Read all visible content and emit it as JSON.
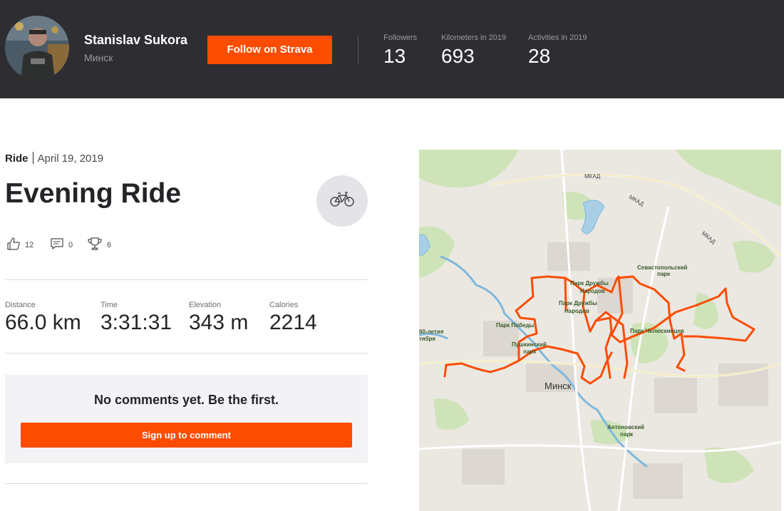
{
  "athlete": {
    "name": "Stanislav Sukora",
    "location": "Минск",
    "follow_label": "Follow on Strava",
    "stats": [
      {
        "label": "Followers",
        "value": "13"
      },
      {
        "label": "Kilometers in 2019",
        "value": "693"
      },
      {
        "label": "Activities in 2019",
        "value": "28"
      }
    ]
  },
  "activity": {
    "type": "Ride",
    "date": "April 19, 2019",
    "title": "Evening Ride",
    "sport_icon": "bike-icon",
    "kudos": "12",
    "comments": "0",
    "achievements": "6",
    "metrics": [
      {
        "label": "Distance",
        "value": "66.0 km"
      },
      {
        "label": "Time",
        "value": "3:31:31"
      },
      {
        "label": "Elevation",
        "value": "343 m"
      },
      {
        "label": "Calories",
        "value": "2214"
      }
    ]
  },
  "comments_section": {
    "empty_text": "No comments yet. Be the first.",
    "signup_label": "Sign up to comment"
  },
  "map": {
    "route_color": "#fc4c02",
    "labels": {
      "mkad1": "МКАД",
      "mkad2": "МКАД",
      "mkad3": "МКАД",
      "sevastopol1": "Севастопольский",
      "sevastopol2": "парк",
      "druzhby1a": "Парк Дружбы",
      "druzhby1b": "Народов",
      "druzhby2a": "Парк Дружбы",
      "druzhby2b": "Народов",
      "pobedy": "Парк Победы",
      "chelyuskintsev": "Парк Челюскинцев",
      "pushkin1": "Пушкинский",
      "pushkin2": "парк",
      "letiya1": "60-летия",
      "letiya2": "тября",
      "city": "Минск",
      "antonov1": "Антоновский",
      "antonov2": "парк"
    }
  },
  "colors": {
    "accent": "#fc4c02",
    "header_bg": "#2d2d32",
    "comment_bg": "#f3f3f6"
  }
}
